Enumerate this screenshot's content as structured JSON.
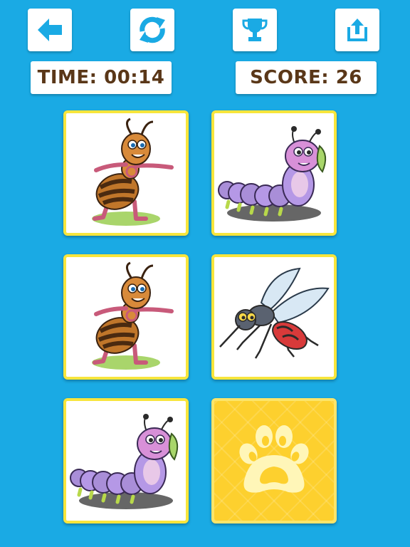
{
  "toolbar": {
    "back_icon": "left-arrow-icon",
    "restart_icon": "refresh-icon",
    "leaderboard_icon": "trophy-icon",
    "share_icon": "share-icon",
    "icon_color": "#1AAAE4"
  },
  "status": {
    "time_label": "TIME: 00:14",
    "score_label": "SCORE: 26"
  },
  "board": {
    "columns": 2,
    "rows": 3,
    "cards": [
      {
        "state": "revealed",
        "picture": "ant"
      },
      {
        "state": "revealed",
        "picture": "caterpillar"
      },
      {
        "state": "revealed",
        "picture": "ant"
      },
      {
        "state": "revealed",
        "picture": "mosquito"
      },
      {
        "state": "revealed",
        "picture": "caterpillar"
      },
      {
        "state": "hidden",
        "picture": "paw-print"
      }
    ]
  },
  "colors": {
    "background": "#1AAAE4",
    "card_border": "#F8E53C",
    "card_back": "#FDD02E",
    "text": "#5A3718"
  }
}
